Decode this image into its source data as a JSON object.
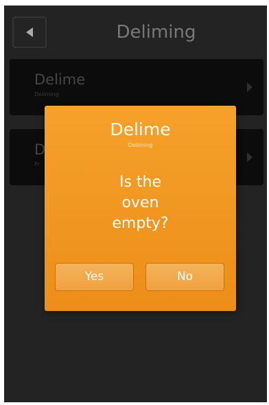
{
  "header": {
    "back_icon": "back-arrow-icon",
    "title": "Deliming"
  },
  "menu": [
    {
      "label": "Delime",
      "sub": "Deliming"
    },
    {
      "label": "D",
      "sub": "Pr"
    }
  ],
  "dialog": {
    "title": "Delime",
    "subtitle": "Deliming",
    "question": "Is the\noven\nempty?",
    "yes_label": "Yes",
    "no_label": "No"
  },
  "colors": {
    "background": "#2d2d2d",
    "dialog_orange": "#f39a22",
    "button_orange": "#f2a94d"
  }
}
